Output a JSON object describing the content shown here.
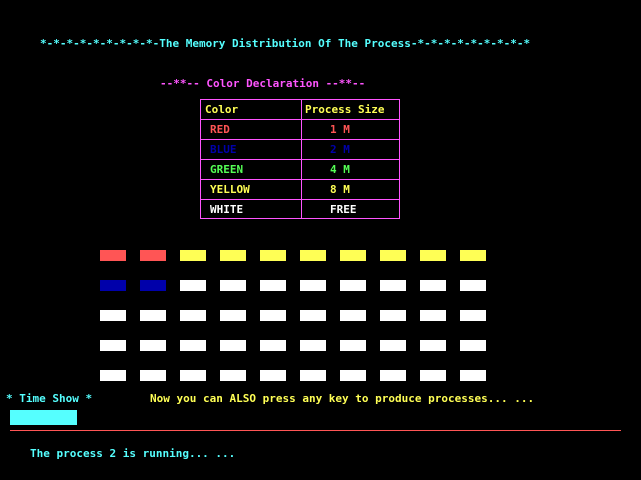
{
  "title": "*-*-*-*-*-*-*-*-*-The Memory Distribution Of The Process-*-*-*-*-*-*-*-*-*",
  "legend": {
    "title": "--**-- Color Declaration --**--",
    "header_color": "Color",
    "header_size": "Process Size",
    "rows": [
      {
        "name": "RED",
        "size": "1 M",
        "color": "#FF5555"
      },
      {
        "name": "BLUE",
        "size": "2 M",
        "color": "#0000AA"
      },
      {
        "name": "GREEN",
        "size": "4 M",
        "color": "#55FF55"
      },
      {
        "name": "YELLOW",
        "size": "8 M",
        "color": "#FFFF55"
      },
      {
        "name": "WHITE",
        "size": "FREE",
        "color": "#FFFFFF"
      }
    ]
  },
  "memory_grid": {
    "rows": [
      [
        "RED",
        "RED",
        "YELLOW",
        "YELLOW",
        "YELLOW",
        "YELLOW",
        "YELLOW",
        "YELLOW",
        "YELLOW",
        "YELLOW"
      ],
      [
        "BLUE",
        "BLUE",
        "WHITE",
        "WHITE",
        "WHITE",
        "WHITE",
        "WHITE",
        "WHITE",
        "WHITE",
        "WHITE"
      ],
      [
        "WHITE",
        "WHITE",
        "WHITE",
        "WHITE",
        "WHITE",
        "WHITE",
        "WHITE",
        "WHITE",
        "WHITE",
        "WHITE"
      ],
      [
        "WHITE",
        "WHITE",
        "WHITE",
        "WHITE",
        "WHITE",
        "WHITE",
        "WHITE",
        "WHITE",
        "WHITE",
        "WHITE"
      ],
      [
        "WHITE",
        "WHITE",
        "WHITE",
        "WHITE",
        "WHITE",
        "WHITE",
        "WHITE",
        "WHITE",
        "WHITE",
        "WHITE"
      ]
    ]
  },
  "time_show_label": "* Time Show *",
  "time_progress": 0.11,
  "message": "Now you can ALSO press any key to produce processes... ...",
  "status": "The process 2 is running... ...",
  "colors": {
    "cyan": "#55FFFF",
    "magenta": "#FF55FF",
    "yellow": "#FFFF55",
    "divider": "#FF5555",
    "background": "#000000"
  }
}
